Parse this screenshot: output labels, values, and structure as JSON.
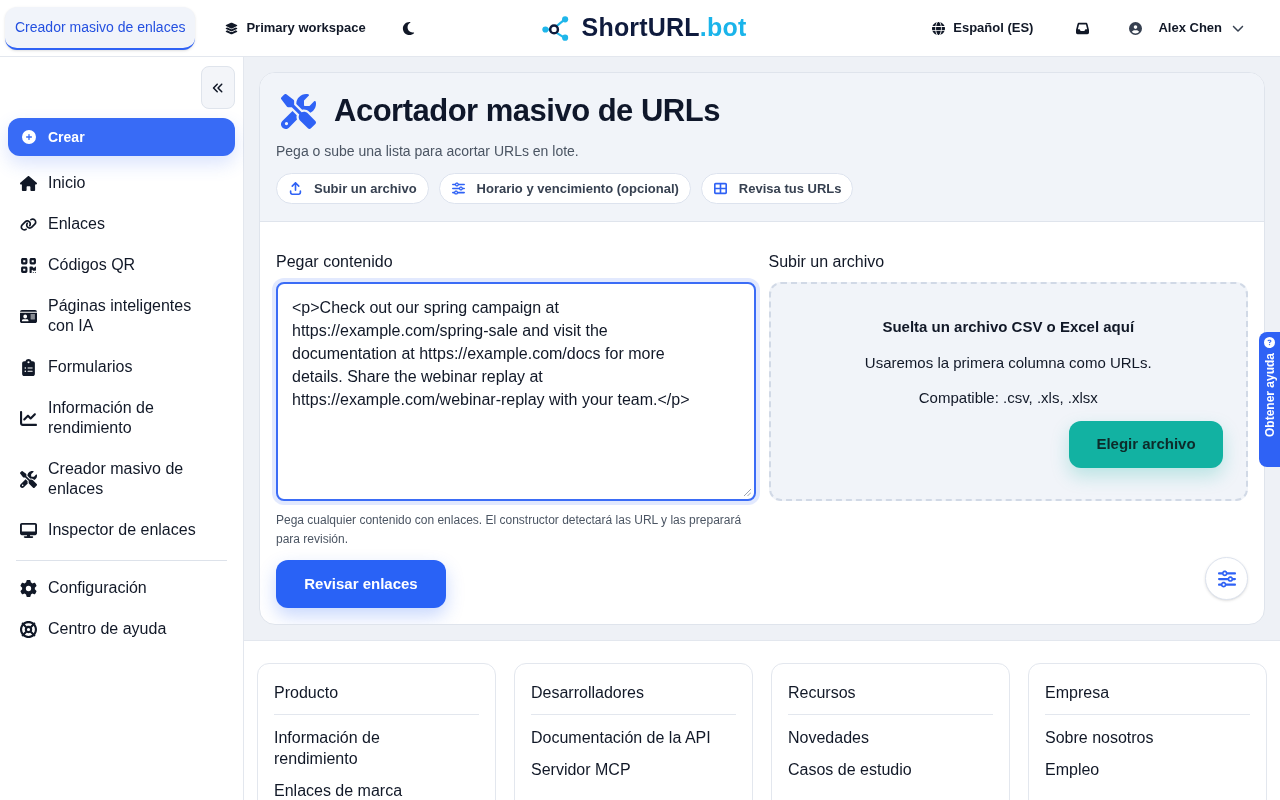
{
  "top_bar": {
    "tabs": [
      {
        "label": "Creador masivo de enlaces",
        "selected": true
      }
    ],
    "workspace": "Primary workspace",
    "brand": {
      "name": "ShortURL",
      "suffix": ".bot"
    },
    "language": "Español (ES)",
    "user": "Alex Chen"
  },
  "sidebar": {
    "create_button": "Crear",
    "items": [
      {
        "label": "Inicio"
      },
      {
        "label": "Enlaces"
      },
      {
        "label": "Códigos QR"
      },
      {
        "label": "Páginas inteligentes con IA"
      },
      {
        "label": "Formularios"
      },
      {
        "label": "Información de rendimiento"
      },
      {
        "label": "Creador masivo de enlaces"
      },
      {
        "label": "Inspector de enlaces"
      }
    ],
    "bottom_items": [
      {
        "label": "Configuración"
      },
      {
        "label": "Centro de ayuda"
      }
    ]
  },
  "page": {
    "title": "Acortador masivo de URLs",
    "subtitle": "Pega o sube una lista para acortar URLs en lote.",
    "steps": [
      {
        "label": "Subir un archivo"
      },
      {
        "label": "Horario y vencimiento (opcional)"
      },
      {
        "label": "Revisa tus URLs"
      }
    ]
  },
  "paste": {
    "label": "Pegar contenido",
    "value": "<p>Check out our spring campaign at https://example.com/spring-sale and visit the documentation at https://example.com/docs for more details. Share the webinar replay at https://example.com/webinar-replay with your team.</p>",
    "focused": true,
    "hint": "Pega cualquier contenido con enlaces. El constructor detectará las URL y las preparará para revisión.",
    "button": "Revisar enlaces"
  },
  "upload": {
    "label": "Subir un archivo",
    "title": "Suelta un archivo CSV o Excel aquí",
    "description": "Usaremos la primera columna como URLs.",
    "formats": "Compatible: .csv, .xls, .xlsx",
    "button": "Elegir archivo"
  },
  "footer": {
    "columns": [
      {
        "title": "Producto",
        "links": [
          "Información de rendimiento",
          "Enlaces de marca"
        ]
      },
      {
        "title": "Desarrolladores",
        "links": [
          "Documentación de la API",
          "Servidor MCP"
        ]
      },
      {
        "title": "Recursos",
        "links": [
          "Novedades",
          "Casos de estudio"
        ]
      },
      {
        "title": "Empresa",
        "links": [
          "Sobre nosotros",
          "Empleo"
        ]
      }
    ]
  },
  "help_tab": {
    "label": "Obtener ayuda"
  }
}
